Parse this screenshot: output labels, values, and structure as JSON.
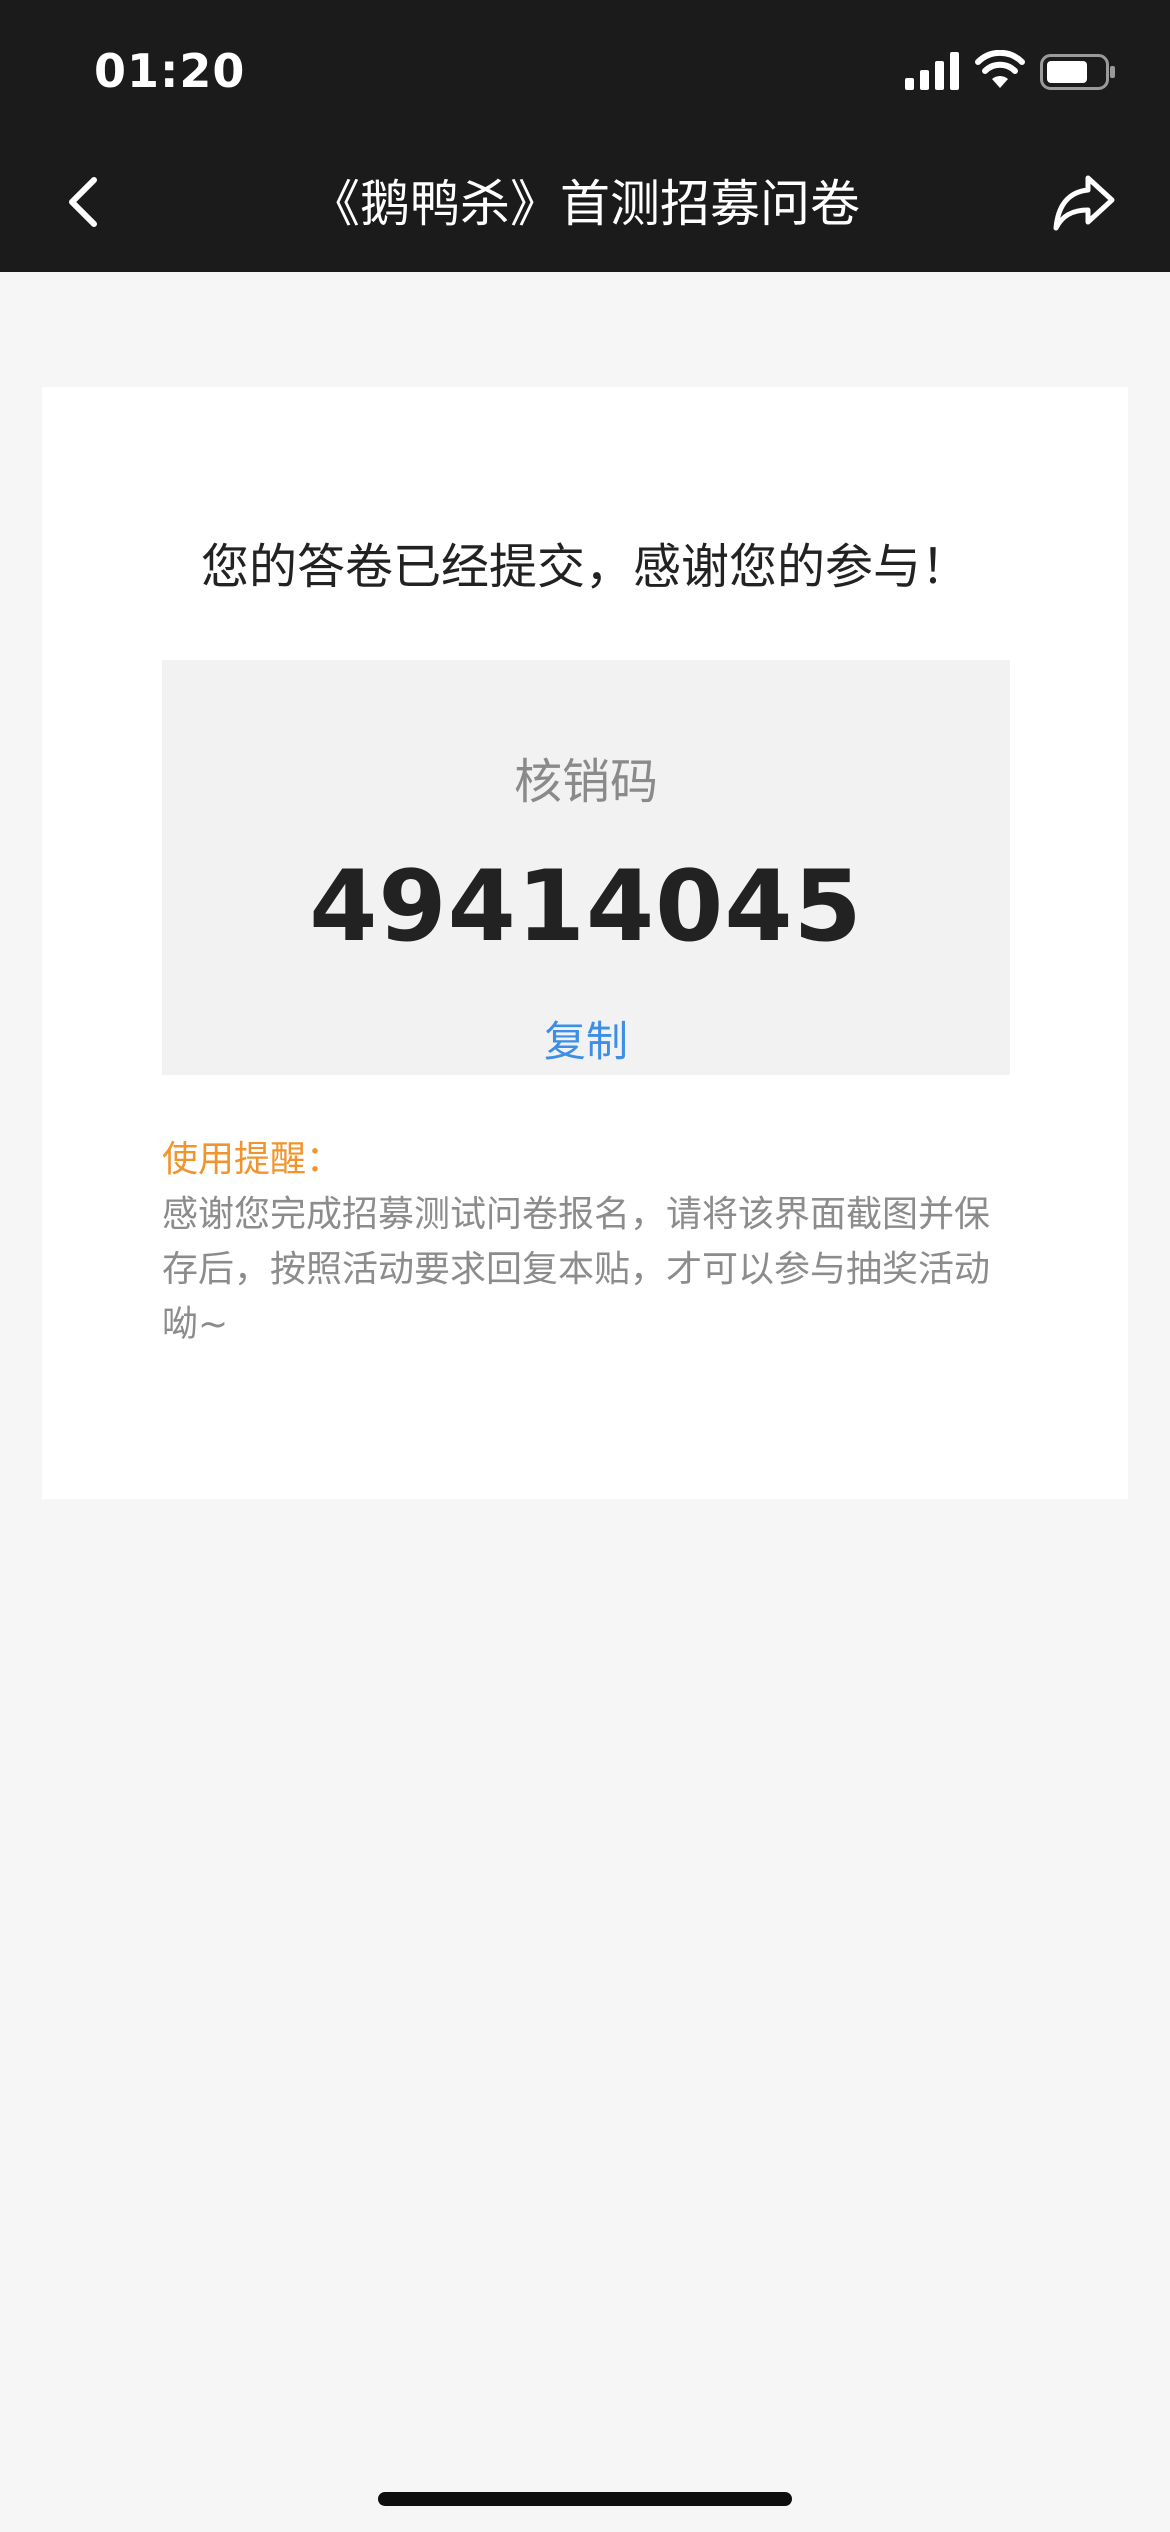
{
  "status_bar": {
    "time": "01:20",
    "icons": [
      "cellular-signal-icon",
      "wifi-icon",
      "battery-icon"
    ]
  },
  "nav": {
    "title": "《鹅鸭杀》首测招募问卷",
    "back_icon": "chevron-left-icon",
    "share_icon": "share-arrow-icon"
  },
  "result": {
    "headline": "您的答卷已经提交，感谢您的参与！",
    "code_label": "核销码",
    "code_value": "49414045",
    "copy_label": "复制",
    "copy_color": "#3d8ee5"
  },
  "tips": {
    "title": "使用提醒：",
    "title_color": "#f0952d",
    "body": "感谢您完成招募测试问卷报名，请将该界面截图并保存后，按照活动要求回复本贴，才可以参与抽奖活动呦~"
  }
}
